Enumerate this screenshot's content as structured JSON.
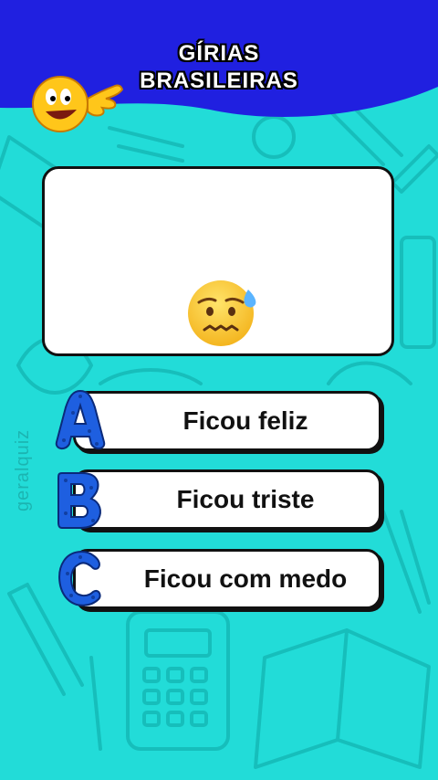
{
  "header": {
    "title_line1": "GÍRIAS",
    "title_line2": "BRASILEIRAS",
    "mascot_icon": "pointing-smiley-icon",
    "bg_color": "#2020e0"
  },
  "question": {
    "emoji_icon": "anxious-sweat-face-icon"
  },
  "answers": [
    {
      "letter": "A",
      "label": "Ficou feliz"
    },
    {
      "letter": "B",
      "label": "Ficou triste"
    },
    {
      "letter": "C",
      "label": "Ficou com medo"
    }
  ],
  "watermark": "geralquiz",
  "colors": {
    "background": "#22dcd8",
    "letter_blue": "#1e5fe0"
  }
}
